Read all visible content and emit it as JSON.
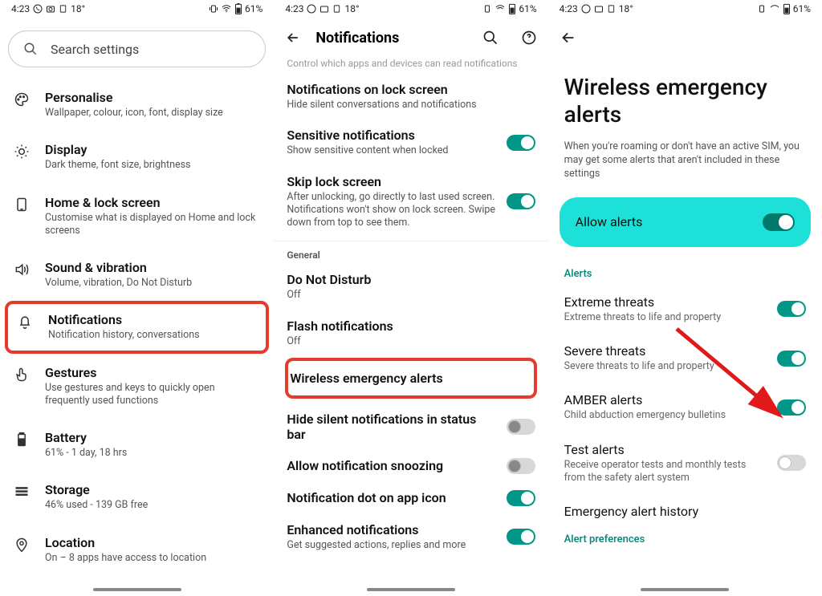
{
  "status": {
    "time": "4:23",
    "temp": "18°",
    "battery": "61%"
  },
  "screen1": {
    "search_placeholder": "Search settings",
    "items": [
      {
        "title": "Personalise",
        "sub": "Wallpaper, colour, icon, font, display size"
      },
      {
        "title": "Display",
        "sub": "Dark theme, font size, brightness"
      },
      {
        "title": "Home & lock screen",
        "sub": "Customise what is displayed on Home and lock screens"
      },
      {
        "title": "Sound & vibration",
        "sub": "Volume, vibration, Do Not Disturb"
      },
      {
        "title": "Notifications",
        "sub": "Notification history, conversations"
      },
      {
        "title": "Gestures",
        "sub": "Use gestures and keys to quickly open frequently used functions"
      },
      {
        "title": "Battery",
        "sub": "61% - 1 day, 18 hrs"
      },
      {
        "title": "Storage",
        "sub": "46% used - 139 GB free"
      },
      {
        "title": "Location",
        "sub": "On – 8 apps have access to location"
      }
    ]
  },
  "screen2": {
    "title": "Notifications",
    "truncated_top": "Control which apps and devices can read notifications",
    "items": [
      {
        "title": "Notifications on lock screen",
        "sub": "Hide silent conversations and notifications",
        "toggle": null
      },
      {
        "title": "Sensitive notifications",
        "sub": "Show sensitive content when locked",
        "toggle": "on"
      },
      {
        "title": "Skip lock screen",
        "sub": "After unlocking, go directly to last used screen. Notifications won't show on lock screen. Swipe down from top to see them.",
        "toggle": "on"
      }
    ],
    "general_label": "General",
    "general": [
      {
        "title": "Do Not Disturb",
        "sub": "Off",
        "toggle": null
      },
      {
        "title": "Flash notifications",
        "sub": "Off",
        "toggle": null
      },
      {
        "title": "Wireless emergency alerts",
        "sub": "",
        "toggle": null
      },
      {
        "title": "Hide silent notifications in status bar",
        "sub": "",
        "toggle": "off"
      },
      {
        "title": "Allow notification snoozing",
        "sub": "",
        "toggle": "off"
      },
      {
        "title": "Notification dot on app icon",
        "sub": "",
        "toggle": "on"
      },
      {
        "title": "Enhanced notifications",
        "sub": "Get suggested actions, replies and more",
        "toggle": "on"
      }
    ]
  },
  "screen3": {
    "title": "Wireless emergency alerts",
    "desc": "When you're roaming or don't have an active SIM, you may get some alerts that aren't included in these settings",
    "allow_label": "Allow alerts",
    "section_alerts": "Alerts",
    "alerts": [
      {
        "title": "Extreme threats",
        "sub": "Extreme threats to life and property",
        "toggle": "on"
      },
      {
        "title": "Severe threats",
        "sub": "Severe threats to life and property",
        "toggle": "on"
      },
      {
        "title": "AMBER alerts",
        "sub": "Child abduction emergency bulletins",
        "toggle": "on"
      },
      {
        "title": "Test alerts",
        "sub": "Receive operator tests and monthly tests from the safety alert system",
        "toggle": "off"
      },
      {
        "title": "Emergency alert history",
        "sub": "",
        "toggle": null
      }
    ],
    "section_prefs": "Alert preferences"
  }
}
